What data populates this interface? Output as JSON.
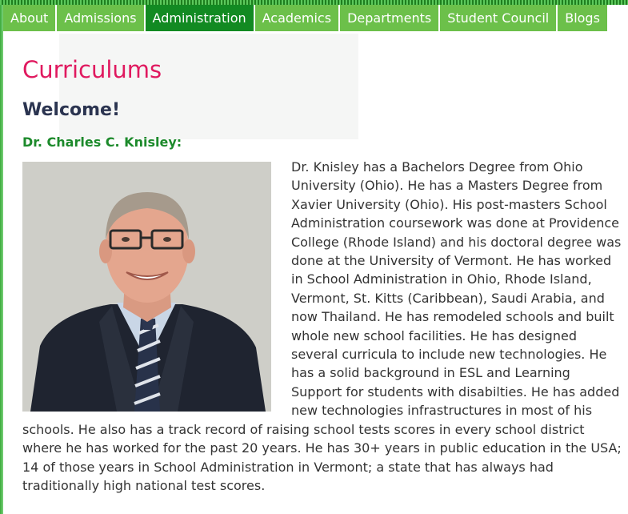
{
  "nav": {
    "items": [
      {
        "label": "About"
      },
      {
        "label": "Admissions"
      },
      {
        "label": "Administration",
        "active": true
      },
      {
        "label": "Academics"
      },
      {
        "label": "Departments"
      },
      {
        "label": "Student Council"
      },
      {
        "label": "Blogs"
      }
    ]
  },
  "page": {
    "title": "Curriculums",
    "welcome": "Welcome!",
    "person_name": "Dr. Charles C. Knisley:",
    "bio": "Dr. Knisley has a Bachelors Degree from Ohio University (Ohio). He has a Masters Degree from Xavier University (Ohio). His post-masters School Administration coursework was done at Providence College (Rhode Island)  and his doctoral degree was done at the University of Vermont. He has worked in School Administration in Ohio, Rhode Island, Vermont, St. Kitts (Caribbean), Saudi Arabia, and now Thailand. He has remodeled schools and built whole new school facilities. He has designed several curricula to include new technologies. He has a solid background in ESL and Learning Support for students with disabilties. He has added new technologies infrastructures in most of his schools. He also has a  track record of raising school tests scores in every school district where he has worked for the past 20 years. He has 30+ years in public education in the USA; 14 of those years in School Administration in Vermont; a state that has always had traditionally high national test scores."
  },
  "colors": {
    "nav_bg": "#6cc04a",
    "nav_active_bg": "#128a22",
    "title": "#e0195f",
    "welcome": "#2b3450",
    "person_name": "#1c8a2b",
    "body_text": "#333333"
  }
}
